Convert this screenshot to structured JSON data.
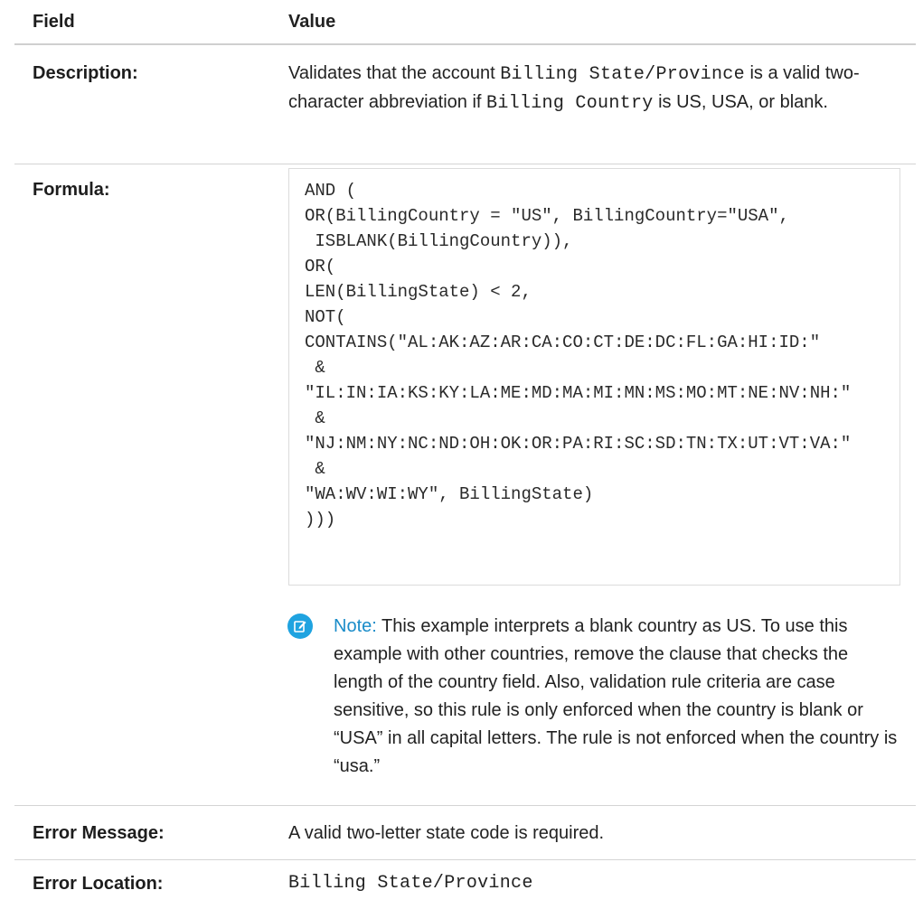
{
  "header": {
    "field_label": "Field",
    "value_label": "Value"
  },
  "description": {
    "label": "Description:",
    "text_1": "Validates that the account ",
    "code_1": "Billing State/Province",
    "text_2": " is a valid two-character abbreviation if ",
    "code_2": "Billing Country",
    "text_3": " is US, USA, or blank."
  },
  "formula": {
    "label": "Formula:",
    "code": "AND (\nOR(BillingCountry = \"US\", BillingCountry=\"USA\",\n ISBLANK(BillingCountry)),\nOR(\nLEN(BillingState) < 2,\nNOT(\nCONTAINS(\"AL:AK:AZ:AR:CA:CO:CT:DE:DC:FL:GA:HI:ID:\"\n &\n\"IL:IN:IA:KS:KY:LA:ME:MD:MA:MI:MN:MS:MO:MT:NE:NV:NH:\"\n &\n\"NJ:NM:NY:NC:ND:OH:OK:OR:PA:RI:SC:SD:TN:TX:UT:VT:VA:\"\n &\n\"WA:WV:WI:WY\", BillingState)\n)))",
    "note_label": "Note:",
    "note_text": "  This example interprets a blank country as US. To use this example with other countries, remove the clause that checks the length of the country field. Also, validation rule criteria are case sensitive, so this rule is only enforced when the country is blank or “USA” in all capital letters. The rule is not enforced when the country is “usa.”"
  },
  "error_message": {
    "label": "Error Message:",
    "value": "A valid two-letter state code is required."
  },
  "error_location": {
    "label": "Error Location:",
    "value": "Billing State/Province"
  },
  "colors": {
    "note_icon": "#1fa3e0",
    "note_label": "#1a8cc9"
  },
  "icons": {
    "note": "edit-note-icon"
  }
}
